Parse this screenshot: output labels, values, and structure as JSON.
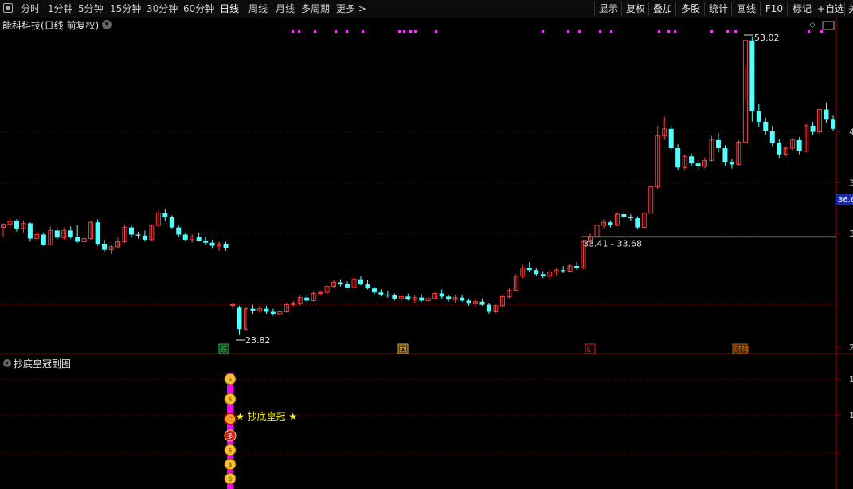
{
  "toolbar": {
    "periods": [
      "分时",
      "1分钟",
      "5分钟",
      "15分钟",
      "30分钟",
      "60分钟",
      "日线",
      "周线",
      "月线",
      "多周期",
      "更多 >"
    ],
    "active_period": "日线",
    "right_buttons": [
      "显示",
      "复权",
      "叠加",
      "多股",
      "统计",
      "画线",
      "F10",
      "标记",
      "+自选",
      "关"
    ]
  },
  "chart": {
    "title": "能科科技(日线 前复权)",
    "high_label": "53.02",
    "low_label": "23.82",
    "range_label": "33.41 - 33.68",
    "price_tag": "36.6",
    "right_ticks": [
      "4",
      "3",
      "3",
      "2"
    ],
    "event_markers": [
      "跌",
      "回",
      "$",
      "财榜"
    ],
    "colors": {
      "up": "#ff3c3c",
      "down": "#54ffff",
      "grid": "#7a0000",
      "magenta": "#ff33ff"
    }
  },
  "indicator": {
    "title": "抄底皇冠副图",
    "signal_label": "★ 抄底皇冠 ★",
    "right_ticks": [
      "1",
      "1"
    ],
    "signal_color": "#ff00ff",
    "label_color": "#ffff00"
  },
  "chart_data": {
    "type": "candlestick",
    "title": "能科科技(日线 前复权)",
    "ohlc": [
      [
        34.6,
        35.0,
        33.7,
        34.9
      ],
      [
        34.9,
        35.6,
        34.4,
        35.2
      ],
      [
        35.2,
        35.4,
        34.2,
        34.5
      ],
      [
        34.5,
        35.3,
        34.1,
        35.0
      ],
      [
        35.0,
        35.1,
        33.2,
        33.5
      ],
      [
        33.5,
        34.2,
        33.3,
        33.9
      ],
      [
        33.9,
        34.1,
        32.8,
        32.9
      ],
      [
        32.9,
        34.7,
        32.8,
        34.3
      ],
      [
        34.3,
        34.6,
        33.4,
        33.6
      ],
      [
        33.6,
        34.6,
        33.4,
        34.3
      ],
      [
        34.3,
        34.7,
        33.5,
        33.7
      ],
      [
        33.7,
        34.8,
        33.1,
        33.2
      ],
      [
        33.2,
        33.7,
        32.6,
        33.5
      ],
      [
        33.5,
        35.3,
        33.4,
        35.1
      ],
      [
        35.1,
        35.4,
        32.8,
        33.0
      ],
      [
        33.0,
        33.4,
        32.2,
        32.4
      ],
      [
        32.4,
        32.9,
        32.0,
        32.7
      ],
      [
        32.7,
        33.6,
        32.5,
        33.2
      ],
      [
        33.2,
        34.8,
        33.1,
        34.6
      ],
      [
        34.6,
        34.8,
        33.6,
        33.9
      ],
      [
        33.9,
        34.2,
        33.5,
        33.8
      ],
      [
        33.8,
        34.3,
        33.2,
        33.4
      ],
      [
        33.4,
        34.9,
        33.3,
        34.8
      ],
      [
        34.8,
        36.3,
        34.6,
        36.0
      ],
      [
        36.0,
        36.4,
        35.2,
        35.6
      ],
      [
        35.6,
        35.8,
        34.4,
        34.6
      ],
      [
        34.6,
        34.8,
        33.7,
        33.9
      ],
      [
        33.9,
        34.1,
        33.3,
        33.4
      ],
      [
        33.4,
        33.9,
        33.1,
        33.7
      ],
      [
        33.7,
        34.1,
        33.2,
        33.3
      ],
      [
        33.3,
        33.7,
        32.9,
        33.1
      ],
      [
        33.1,
        33.4,
        32.5,
        32.8
      ],
      [
        32.8,
        33.2,
        32.3,
        33.0
      ],
      [
        33.0,
        33.2,
        32.3,
        32.6
      ],
      [
        27.0,
        27.2,
        26.6,
        27.0
      ],
      [
        26.7,
        26.9,
        24.0,
        24.6
      ],
      [
        24.6,
        26.8,
        24.5,
        26.6
      ],
      [
        26.6,
        27.0,
        26.1,
        26.4
      ],
      [
        26.4,
        26.9,
        26.2,
        26.6
      ],
      [
        26.6,
        26.9,
        26.1,
        26.3
      ],
      [
        26.3,
        26.6,
        25.9,
        26.1
      ],
      [
        26.1,
        26.5,
        25.8,
        26.3
      ],
      [
        26.3,
        27.2,
        26.2,
        27.0
      ],
      [
        27.0,
        27.4,
        26.8,
        27.1
      ],
      [
        27.1,
        27.9,
        26.9,
        27.7
      ],
      [
        27.7,
        28.0,
        27.3,
        27.4
      ],
      [
        27.4,
        28.3,
        27.3,
        28.1
      ],
      [
        28.1,
        28.4,
        27.9,
        28.2
      ],
      [
        28.2,
        28.9,
        28.0,
        28.8
      ],
      [
        28.8,
        29.4,
        28.6,
        29.2
      ],
      [
        29.2,
        29.5,
        28.8,
        29.0
      ],
      [
        29.0,
        29.3,
        28.6,
        28.7
      ],
      [
        28.7,
        29.7,
        28.6,
        29.5
      ],
      [
        29.5,
        29.8,
        28.9,
        29.0
      ],
      [
        29.0,
        29.4,
        28.5,
        28.6
      ],
      [
        28.6,
        28.8,
        28.0,
        28.2
      ],
      [
        28.2,
        28.5,
        27.8,
        28.0
      ],
      [
        28.0,
        28.3,
        27.7,
        27.9
      ],
      [
        27.9,
        28.1,
        27.4,
        27.6
      ],
      [
        27.6,
        28.0,
        27.3,
        27.8
      ],
      [
        27.8,
        28.1,
        27.4,
        27.5
      ],
      [
        27.5,
        27.9,
        27.2,
        27.7
      ],
      [
        27.7,
        28.0,
        27.3,
        27.4
      ],
      [
        27.4,
        27.8,
        27.1,
        27.6
      ],
      [
        27.6,
        28.2,
        27.5,
        28.1
      ],
      [
        28.1,
        28.5,
        27.6,
        27.8
      ],
      [
        27.8,
        28.0,
        27.3,
        27.5
      ],
      [
        27.5,
        27.9,
        27.2,
        27.7
      ],
      [
        27.7,
        28.0,
        27.3,
        27.4
      ],
      [
        27.4,
        27.6,
        26.9,
        27.1
      ],
      [
        27.1,
        27.5,
        26.8,
        27.3
      ],
      [
        27.3,
        27.6,
        26.9,
        27.0
      ],
      [
        27.0,
        27.2,
        26.1,
        26.3
      ],
      [
        26.3,
        27.0,
        26.2,
        26.9
      ],
      [
        26.9,
        28.0,
        26.8,
        27.8
      ],
      [
        27.8,
        28.6,
        27.6,
        28.4
      ],
      [
        28.4,
        30.0,
        28.3,
        29.8
      ],
      [
        29.8,
        30.9,
        29.6,
        30.6
      ],
      [
        30.6,
        31.2,
        30.2,
        30.4
      ],
      [
        30.4,
        30.6,
        29.8,
        30.0
      ],
      [
        30.0,
        30.3,
        29.6,
        29.8
      ],
      [
        29.8,
        30.4,
        29.5,
        30.2
      ],
      [
        30.2,
        30.6,
        29.9,
        30.4
      ],
      [
        30.4,
        30.8,
        30.1,
        30.3
      ],
      [
        30.3,
        31.0,
        30.2,
        30.8
      ],
      [
        30.8,
        31.2,
        30.4,
        30.6
      ],
      [
        30.6,
        33.4,
        30.5,
        33.2
      ],
      [
        33.2,
        34.0,
        32.9,
        33.7
      ],
      [
        33.7,
        35.0,
        33.6,
        34.8
      ],
      [
        34.8,
        35.4,
        34.5,
        35.1
      ],
      [
        35.1,
        35.3,
        34.6,
        34.8
      ],
      [
        34.8,
        36.1,
        34.7,
        35.9
      ],
      [
        35.9,
        36.2,
        35.4,
        35.6
      ],
      [
        35.6,
        35.9,
        35.2,
        35.5
      ],
      [
        35.5,
        35.7,
        34.4,
        34.6
      ],
      [
        34.6,
        36.2,
        34.5,
        36.0
      ],
      [
        36.0,
        38.8,
        35.9,
        38.6
      ],
      [
        38.6,
        44.6,
        38.4,
        43.6
      ],
      [
        43.6,
        45.5,
        43.2,
        44.3
      ],
      [
        44.3,
        44.6,
        42.1,
        42.4
      ],
      [
        42.4,
        42.8,
        40.2,
        40.5
      ],
      [
        40.5,
        41.8,
        40.3,
        41.6
      ],
      [
        41.6,
        41.9,
        40.6,
        40.9
      ],
      [
        40.9,
        41.2,
        40.3,
        40.6
      ],
      [
        40.6,
        41.5,
        40.4,
        41.2
      ],
      [
        41.2,
        43.6,
        41.1,
        43.2
      ],
      [
        43.2,
        43.9,
        42.0,
        42.4
      ],
      [
        42.4,
        42.7,
        40.7,
        41.0
      ],
      [
        41.0,
        41.3,
        40.4,
        40.8
      ],
      [
        40.8,
        43.2,
        40.7,
        43.0
      ],
      [
        43.0,
        50.4,
        47.1,
        53.0
      ],
      [
        53.0,
        53.4,
        45.0,
        46.0
      ],
      [
        46.0,
        46.8,
        44.5,
        45.0
      ],
      [
        45.0,
        45.4,
        43.7,
        44.1
      ],
      [
        44.1,
        44.6,
        42.6,
        42.9
      ],
      [
        42.9,
        43.3,
        41.4,
        41.8
      ],
      [
        41.8,
        42.6,
        41.6,
        42.4
      ],
      [
        42.4,
        43.4,
        42.2,
        43.2
      ],
      [
        43.2,
        43.5,
        41.8,
        42.1
      ],
      [
        42.1,
        44.8,
        42.0,
        44.6
      ],
      [
        44.6,
        45.0,
        43.7,
        44.0
      ],
      [
        44.0,
        46.4,
        43.8,
        46.2
      ],
      [
        46.2,
        46.9,
        44.9,
        45.2
      ],
      [
        45.2,
        45.6,
        44.1,
        44.3
      ]
    ],
    "high": 53.02,
    "low": 23.82,
    "range_box": [
      33.41,
      33.68
    ],
    "last_price": 36.6
  }
}
